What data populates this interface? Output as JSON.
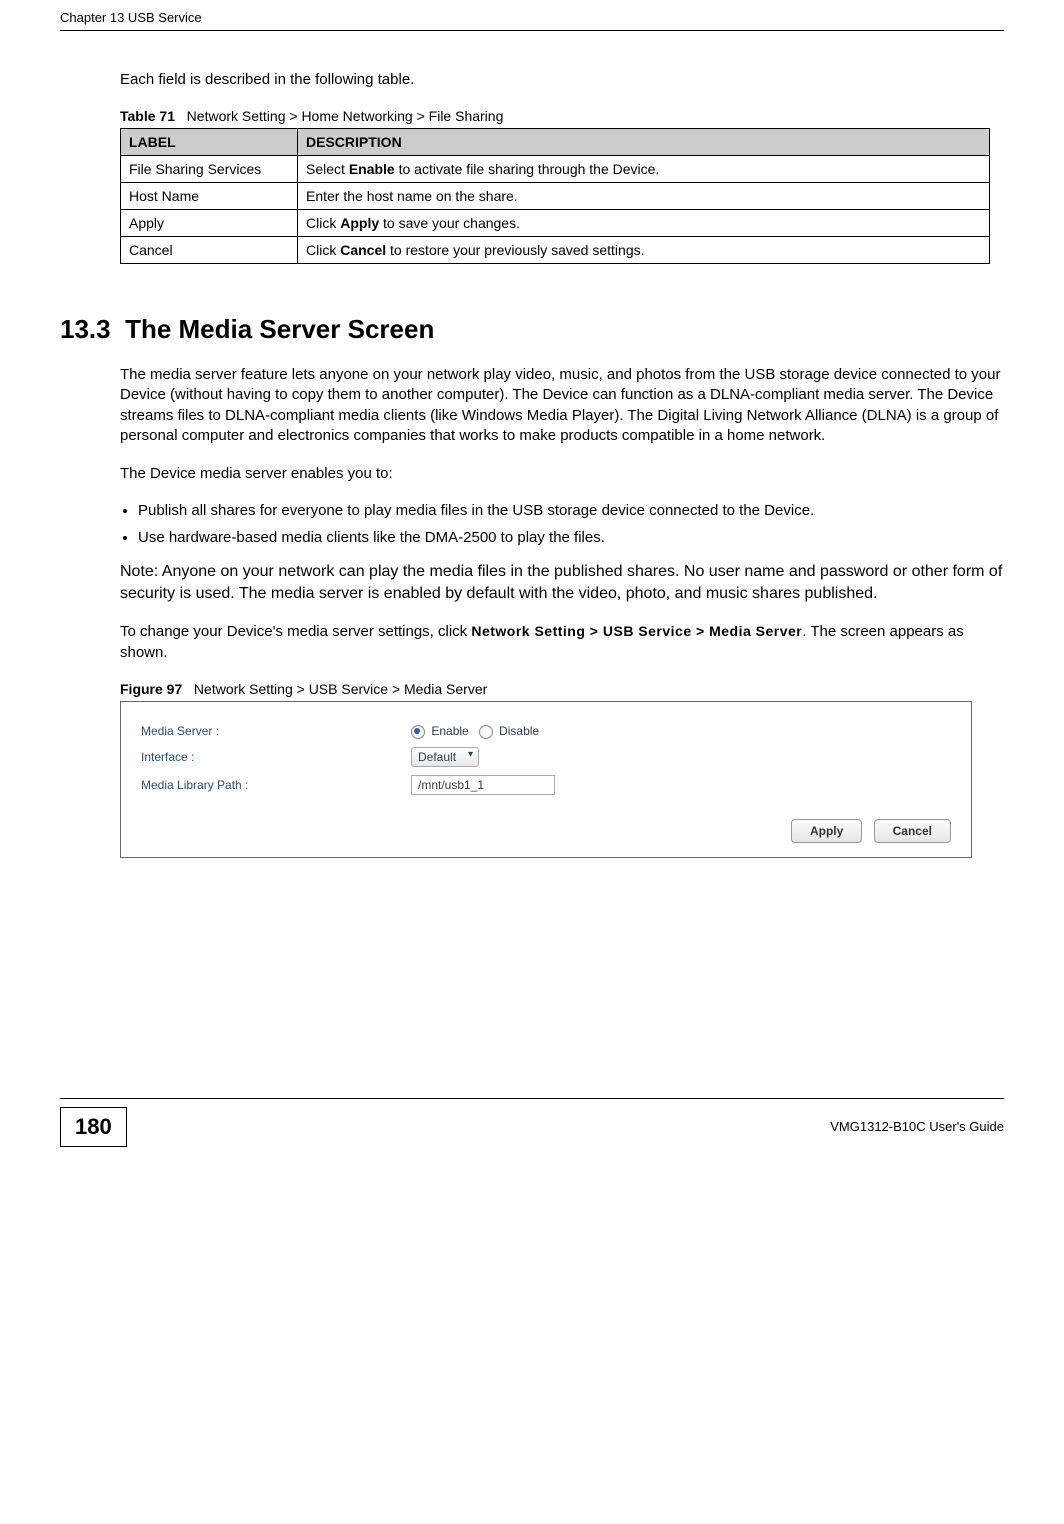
{
  "header": {
    "chapter": "Chapter 13 USB Service"
  },
  "intro": "Each field is described in the following table.",
  "table71": {
    "caption_prefix": "Table 71",
    "caption": "Network Setting > Home Networking > File Sharing",
    "headers": {
      "label": "LABEL",
      "description": "DESCRIPTION"
    },
    "rows": [
      {
        "label": "File Sharing Services",
        "desc_pre": "Select ",
        "desc_bold": "Enable",
        "desc_post": " to activate file sharing through the Device."
      },
      {
        "label": "Host Name",
        "desc_pre": "Enter the host name on the share.",
        "desc_bold": "",
        "desc_post": ""
      },
      {
        "label": "Apply",
        "desc_pre": "Click ",
        "desc_bold": "Apply",
        "desc_post": " to save your changes."
      },
      {
        "label": "Cancel",
        "desc_pre": "Click ",
        "desc_bold": "Cancel",
        "desc_post": " to restore your previously saved settings."
      }
    ]
  },
  "section": {
    "number": "13.3",
    "title": "The Media Server Screen"
  },
  "para1": "The media server feature lets anyone on your network play video, music, and photos from the USB storage device connected to your Device (without having to copy them to another computer). The Device can function as a DLNA-compliant media server. The Device streams files to DLNA-compliant media clients (like Windows Media Player). The Digital Living Network Alliance (DLNA) is a group of personal computer and electronics companies that works to make products compatible in a home network.",
  "para2": "The Device media server enables you to:",
  "bullets": [
    "Publish all shares for everyone to play media files in the USB storage device connected to the Device.",
    "Use hardware-based media clients like the DMA-2500 to play the files."
  ],
  "note": "Note: Anyone on your network can play the media files in the published shares. No user name and password or other form of security is used. The media server is enabled by default with the video, photo, and music shares published.",
  "para3_pre": "To change your Device's media server settings, click ",
  "para3_bold": "Network Setting >  USB Service >  Media Server",
  "para3_post": ". The screen appears as shown.",
  "figure97": {
    "caption_prefix": "Figure 97",
    "caption": "Network Setting > USB Service > Media Server",
    "labels": {
      "media_server": "Media Server :",
      "interface": "Interface :",
      "media_library_path": "Media Library Path :"
    },
    "values": {
      "radio_enable": "Enable",
      "radio_disable": "Disable",
      "interface_selected": "Default",
      "media_library_path": "/mnt/usb1_1"
    },
    "buttons": {
      "apply": "Apply",
      "cancel": "Cancel"
    }
  },
  "footer": {
    "page": "180",
    "guide": "VMG1312-B10C User's Guide"
  }
}
